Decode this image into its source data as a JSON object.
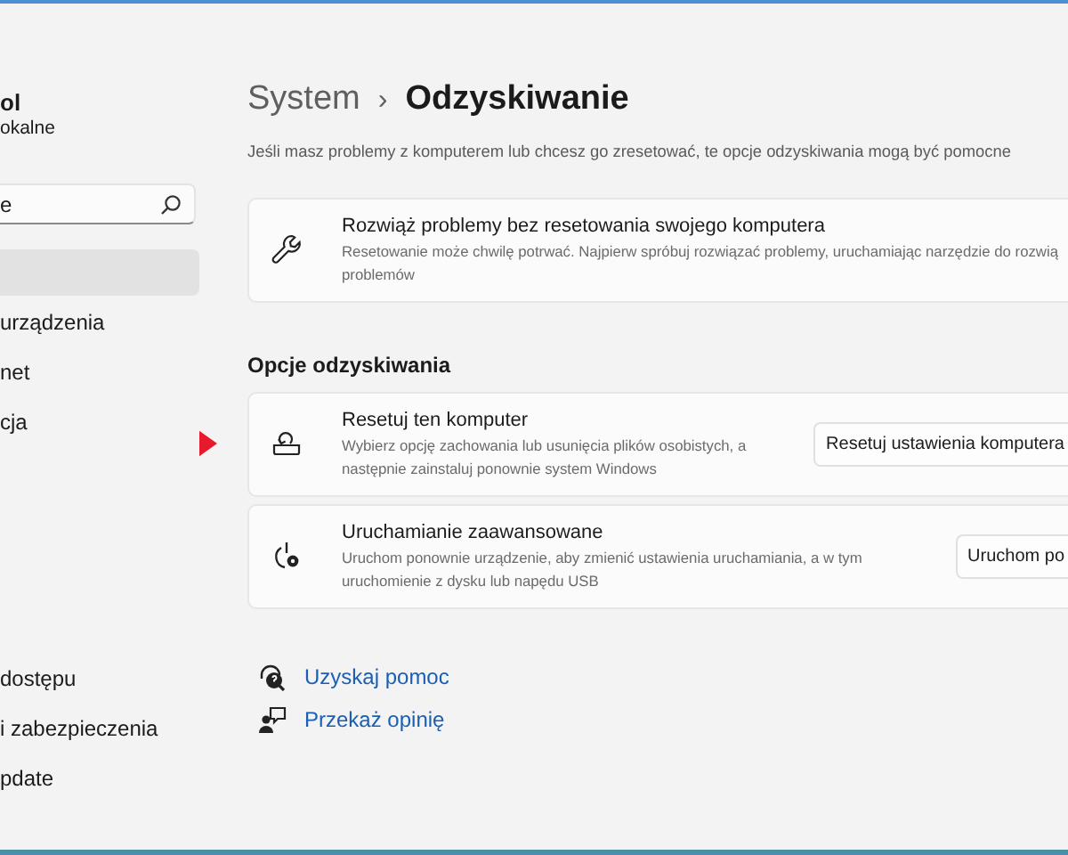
{
  "sidebar": {
    "user": {
      "name": "ol",
      "subtitle": "okalne"
    },
    "search": {
      "value": "e"
    },
    "items": [
      {
        "selected": true
      },
      {
        "label": "urządzenia",
        "selected": false
      },
      {
        "label": "net",
        "selected": false
      },
      {
        "label": "cja",
        "selected": false
      },
      {
        "label": "dostępu",
        "selected": false
      },
      {
        "label": "i zabezpieczenia",
        "selected": false
      },
      {
        "label": "pdate",
        "selected": false
      }
    ]
  },
  "breadcrumb": {
    "parent": "System",
    "separator": "›",
    "current": "Odzyskiwanie"
  },
  "description": "Jeśli masz problemy z komputerem lub chcesz go zresetować, te opcje odzyskiwania mogą być pomocne",
  "troubleshoot_card": {
    "title": "Rozwiąż problemy bez resetowania swojego komputera",
    "description_lines": [
      "Resetowanie może chwilę potrwać. Najpierw spróbuj rozwiązać problemy, uruchamiając narzędzie do rozwią",
      "problemów"
    ]
  },
  "section_title": "Opcje odzyskiwania",
  "options": [
    {
      "title": "Resetuj ten komputer",
      "description_lines": [
        "Wybierz opcję zachowania lub usunięcia plików osobistych, a",
        "następnie zainstaluj ponownie system Windows"
      ],
      "button": "Resetuj ustawienia komputera"
    },
    {
      "title": "Uruchamianie zaawansowane",
      "description_lines": [
        "Uruchom ponownie urządzenie, aby zmienić ustawienia uruchamiania, a w tym",
        "uruchomienie z dysku lub napędu USB"
      ],
      "button": "Uruchom po"
    }
  ],
  "links": [
    {
      "label": "Uzyskaj pomoc"
    },
    {
      "label": "Przekaż opinię"
    }
  ],
  "annotation": {
    "kind": "arrow"
  }
}
